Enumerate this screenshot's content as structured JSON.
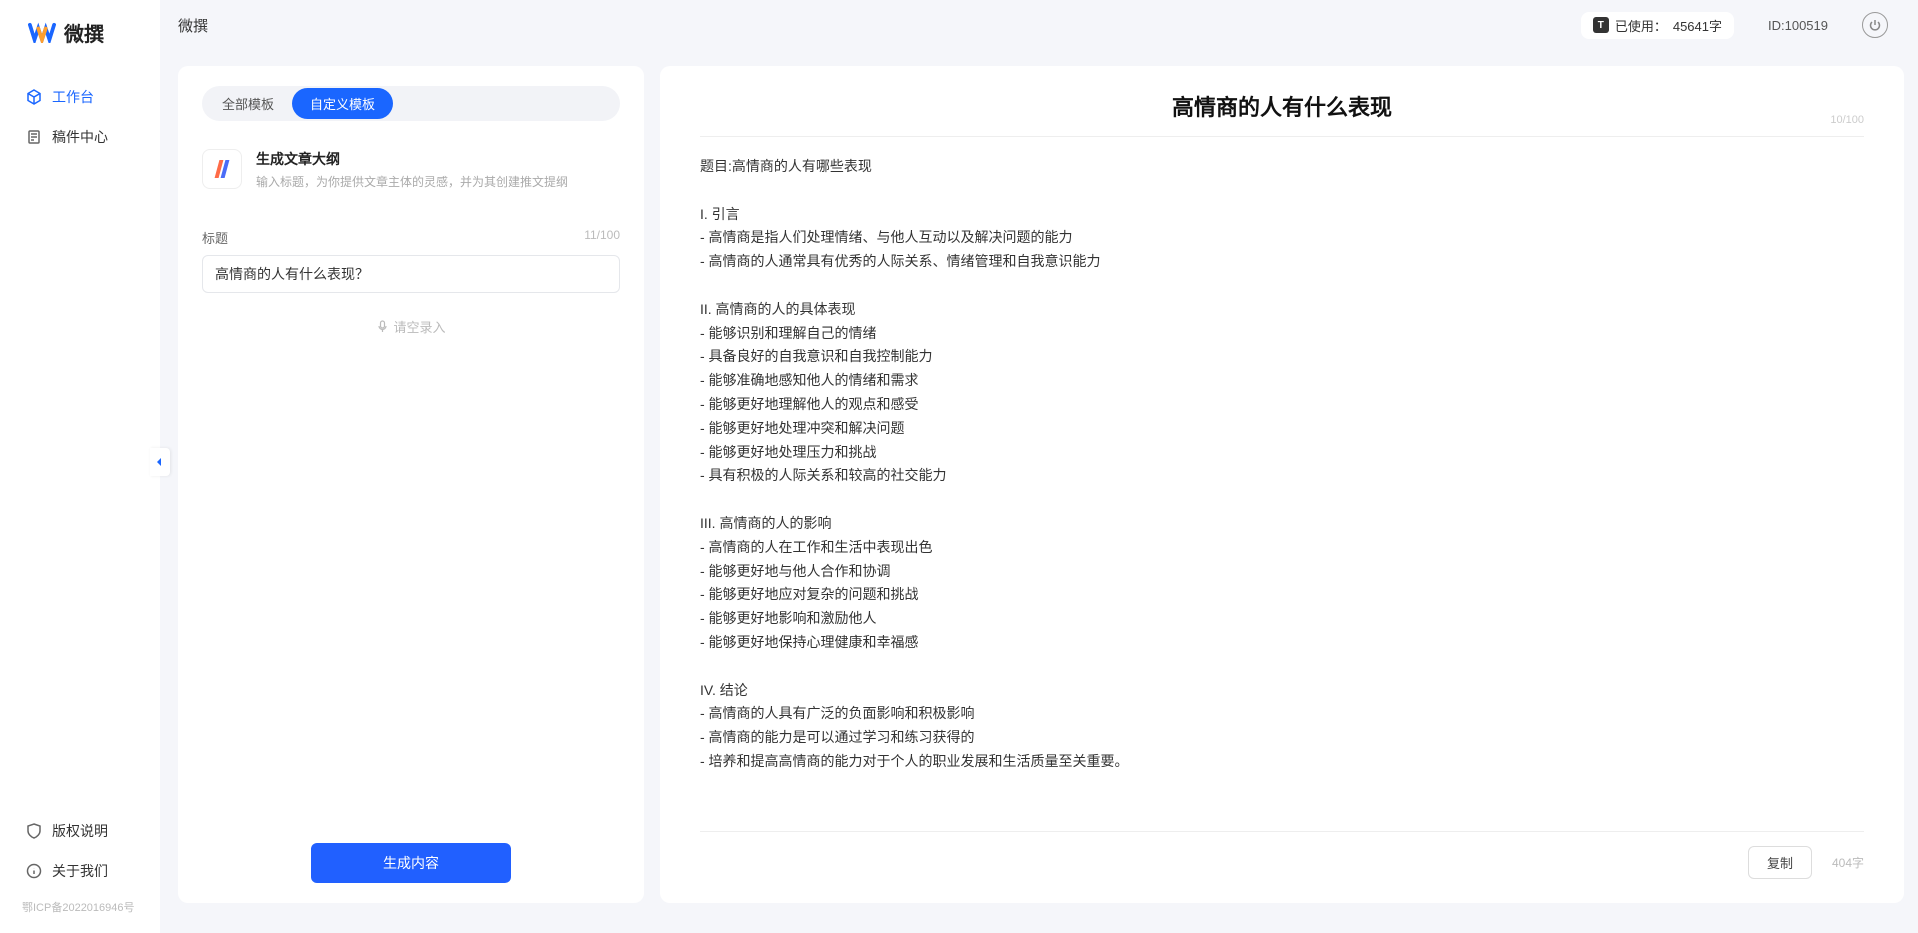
{
  "app": {
    "name": "微撰",
    "logo_text": "微撰"
  },
  "sidebar": {
    "nav": [
      {
        "label": "工作台",
        "active": true
      },
      {
        "label": "稿件中心",
        "active": false
      }
    ],
    "bottom": [
      {
        "label": "版权说明"
      },
      {
        "label": "关于我们"
      }
    ],
    "icp": "鄂ICP备2022016946号"
  },
  "topbar": {
    "usage_prefix": "已使用：",
    "usage_value": "45641字",
    "id_label": "ID:100519"
  },
  "tabs": {
    "all": "全部模板",
    "custom": "自定义模板"
  },
  "template": {
    "title": "生成文章大纲",
    "desc": "输入标题，为你提供文章主体的灵感，并为其创建推文提纲"
  },
  "field": {
    "label": "标题",
    "count": "11/100",
    "value": "高情商的人有什么表现？"
  },
  "record_hint": "请空录入",
  "generate": "生成内容",
  "output": {
    "title": "高情商的人有什么表现",
    "title_count": "10/100",
    "body": "题目:高情商的人有哪些表现\n\nI. 引言\n- 高情商是指人们处理情绪、与他人互动以及解决问题的能力\n- 高情商的人通常具有优秀的人际关系、情绪管理和自我意识能力\n\nII. 高情商的人的具体表现\n- 能够识别和理解自己的情绪\n- 具备良好的自我意识和自我控制能力\n- 能够准确地感知他人的情绪和需求\n- 能够更好地理解他人的观点和感受\n- 能够更好地处理冲突和解决问题\n- 能够更好地处理压力和挑战\n- 具有积极的人际关系和较高的社交能力\n\nIII. 高情商的人的影响\n- 高情商的人在工作和生活中表现出色\n- 能够更好地与他人合作和协调\n- 能够更好地应对复杂的问题和挑战\n- 能够更好地影响和激励他人\n- 能够更好地保持心理健康和幸福感\n\nIV. 结论\n- 高情商的人具有广泛的负面影响和积极影响\n- 高情商的能力是可以通过学习和练习获得的\n- 培养和提高高情商的能力对于个人的职业发展和生活质量至关重要。",
    "copy": "复制",
    "word_count": "404字"
  }
}
